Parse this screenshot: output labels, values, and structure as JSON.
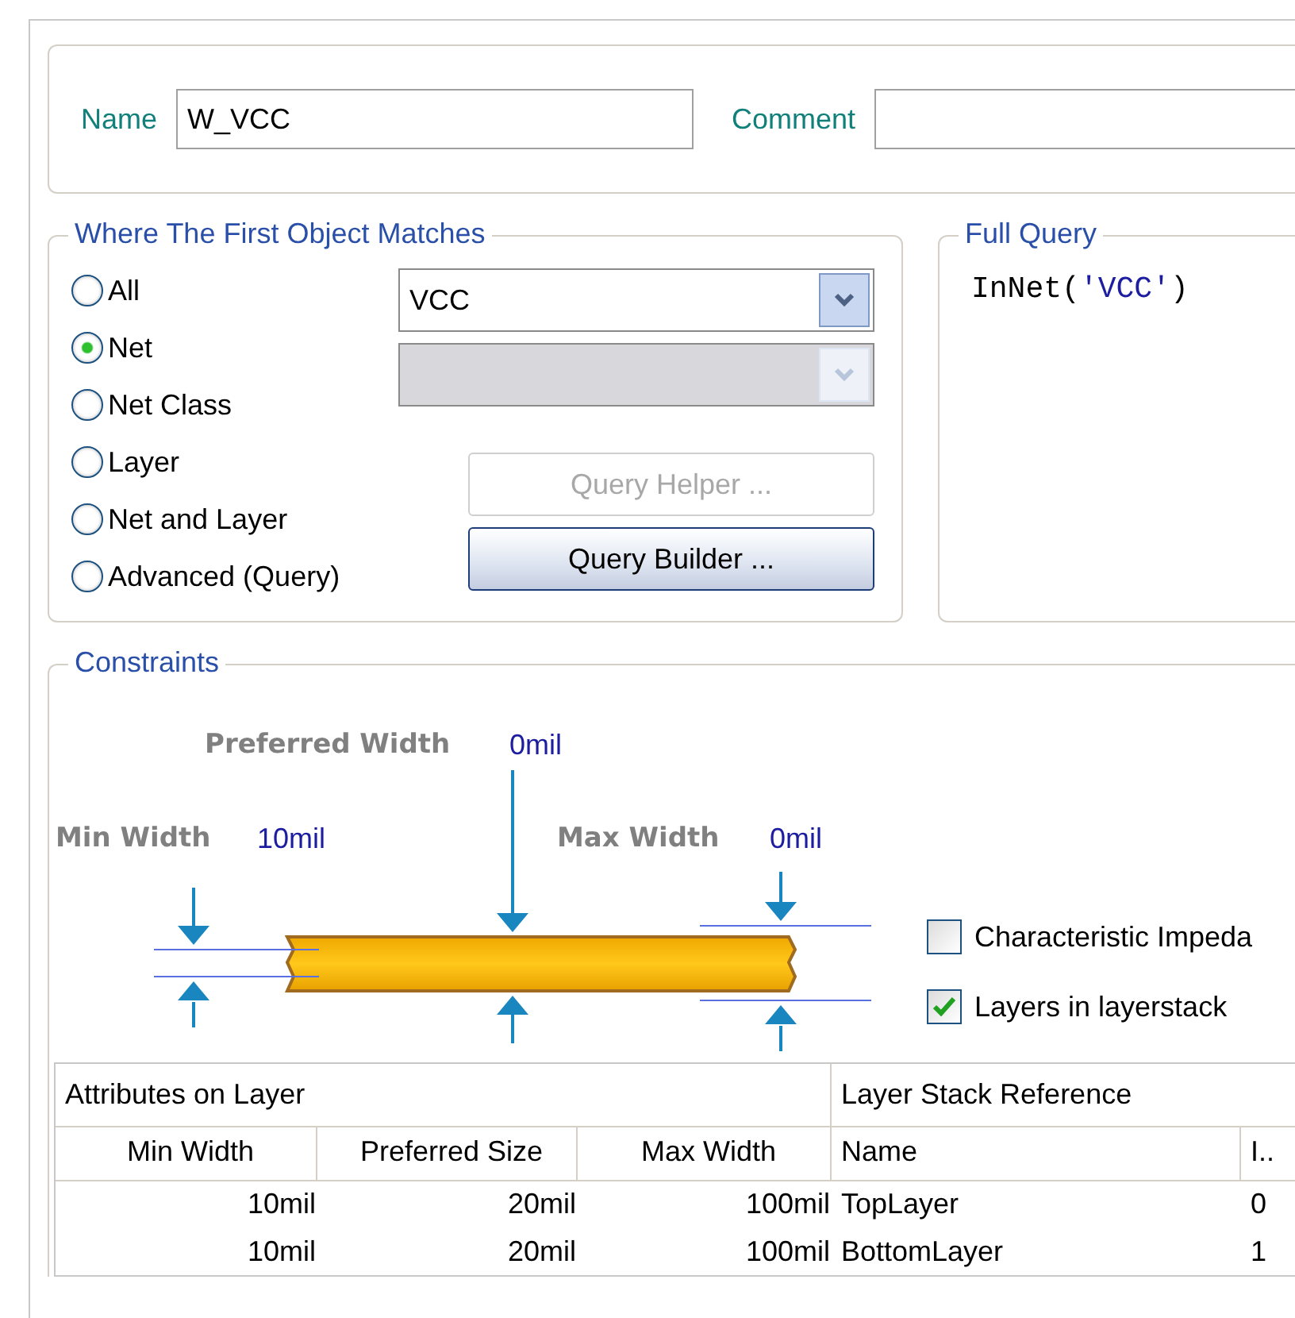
{
  "name_field": {
    "label": "Name",
    "value": "W_VCC"
  },
  "comment_field": {
    "label": "Comment"
  },
  "where_group": {
    "title": "Where The First Object Matches",
    "options": [
      {
        "label": "All",
        "selected": false
      },
      {
        "label": "Net",
        "selected": true
      },
      {
        "label": "Net Class",
        "selected": false
      },
      {
        "label": "Layer",
        "selected": false
      },
      {
        "label": "Net and Layer",
        "selected": false
      },
      {
        "label": "Advanced (Query)",
        "selected": false
      }
    ],
    "net_combo": {
      "value": "VCC",
      "disabled": false
    },
    "class_combo": {
      "disabled": true
    },
    "buttons": [
      {
        "label": "Query Helper ...",
        "disabled": true
      },
      {
        "label": "Query Builder ...",
        "disabled": false
      }
    ]
  },
  "full_query": {
    "title": "Full Query",
    "parts": [
      {
        "kind": "code",
        "text": "InNet("
      },
      {
        "kind": "string",
        "text": "'VCC'"
      },
      {
        "kind": "code",
        "text": ")"
      }
    ]
  },
  "constraints": {
    "title": "Constraints",
    "labels": [
      {
        "kind": "preferred",
        "name": "Preferred Width",
        "value": "0mil"
      },
      {
        "kind": "min",
        "name": "Min Width",
        "value": "10mil"
      },
      {
        "kind": "max",
        "name": "Max Width",
        "value": "0mil"
      }
    ],
    "checkboxes": [
      {
        "label": "Characteristic Impeda",
        "checked": false
      },
      {
        "label": "Layers in layerstack",
        "checked": true
      }
    ],
    "table": {
      "groups": [
        "Attributes on Layer",
        "Layer Stack Reference"
      ],
      "columns": [
        "Min Width",
        "Preferred Size",
        "Max Width",
        "Name",
        "I.."
      ],
      "rows": [
        [
          "10mil",
          "20mil",
          "100mil",
          "TopLayer",
          "0"
        ],
        [
          "10mil",
          "20mil",
          "100mil",
          "BottomLayer",
          "1"
        ]
      ]
    }
  }
}
